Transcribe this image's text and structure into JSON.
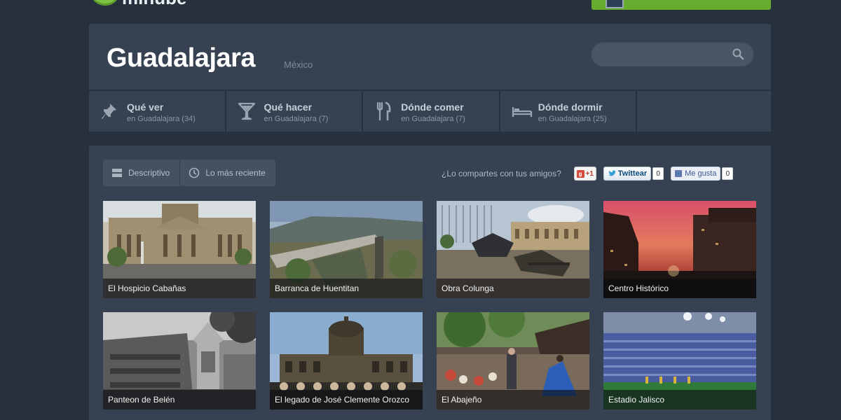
{
  "brand": {
    "logo_text": "minube",
    "accent": "#67ac2e"
  },
  "header": {
    "city": "Guadalajara",
    "country": "México",
    "search": {
      "placeholder": "",
      "icon": "search-icon"
    }
  },
  "categories": [
    {
      "title": "Qué ver",
      "sub": "en Guadalajara (34)",
      "icon": "pin-icon"
    },
    {
      "title": "Qué hacer",
      "sub": "en Guadalajara (7)",
      "icon": "cocktail-icon"
    },
    {
      "title": "Dónde comer",
      "sub": "en Guadalajara (7)",
      "icon": "fork-knife-icon"
    },
    {
      "title": "Dónde dormir",
      "sub": "en Guadalajara (25)",
      "icon": "bed-icon"
    }
  ],
  "tabs": [
    {
      "label": "Descriptivo",
      "icon": "list-icon"
    },
    {
      "label": "Lo más reciente",
      "icon": "clock-icon"
    }
  ],
  "share": {
    "label": "¿Lo compartes con tus amigos?",
    "gplus": "+1",
    "twitter_label": "Twittear",
    "twitter_count": "0",
    "facebook_label": "Me gusta",
    "facebook_count": "0"
  },
  "places": [
    {
      "name": "El Hospicio Cabañas"
    },
    {
      "name": "Barranca de Huentitan"
    },
    {
      "name": "Obra Colunga"
    },
    {
      "name": "Centro Histórico"
    },
    {
      "name": "Panteon de Belén"
    },
    {
      "name": "El legado de José Clemente Orozco"
    },
    {
      "name": "El Abajeño"
    },
    {
      "name": "Estadio Jalisco"
    }
  ]
}
